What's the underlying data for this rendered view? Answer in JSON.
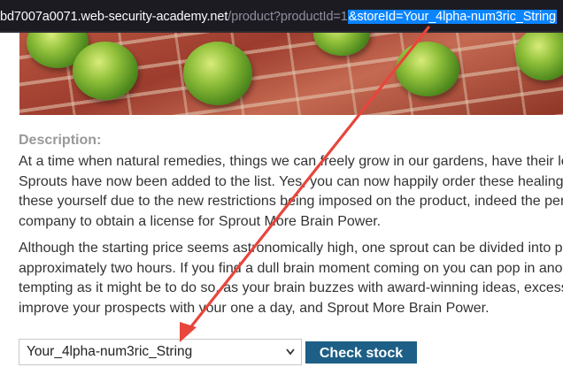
{
  "url_bar": {
    "host": "bd7007a0071.web-security-academy.net",
    "path": "/product?productId=1",
    "selected": "&storeId=Your_4lpha-num3ric_String"
  },
  "product": {
    "description_label": "Description:",
    "paragraph1": [
      "At a time when natural remedies, things we can freely grow in our gardens, have their le",
      "Sprouts have now been added to the list. Yes, you can now happily order these healing",
      "these yourself due to the new restrictions being imposed on the product, indeed the per",
      "company to obtain a license for Sprout More Brain Power."
    ],
    "paragraph2": [
      "Although the starting price seems astronomically high, one sprout can be divided into p",
      "approximately two hours. If you find a dull brain moment coming on you can pop in anot",
      "tempting as it might be to do so, as your brain buzzes with award-winning ideas, excess",
      "improve your prospects with your one a day, and Sprout More Brain Power."
    ]
  },
  "stock_check": {
    "selected_store": "Your_4lpha-num3ric_String",
    "button_label": "Check stock"
  },
  "annotation": {
    "arrow_color": "#e8453c"
  }
}
